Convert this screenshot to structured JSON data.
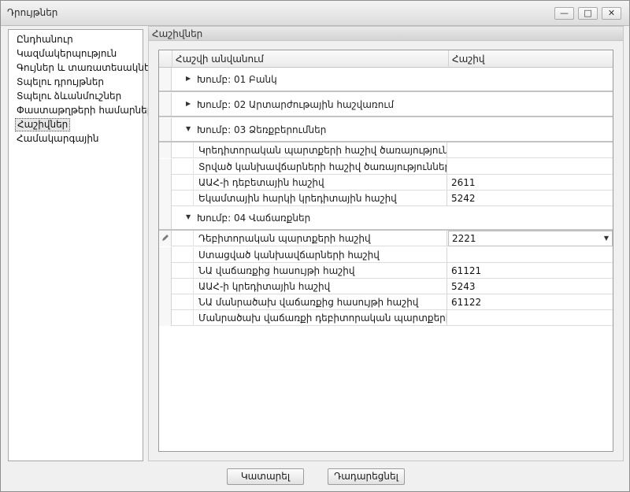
{
  "window": {
    "title": "Դրույթներ",
    "controls": {
      "minimize": "—",
      "maximize": "□",
      "close": "✕"
    }
  },
  "nav": {
    "items": [
      {
        "label": "Ընդհանուր",
        "selected": false
      },
      {
        "label": "Կազմակերպություն",
        "selected": false
      },
      {
        "label": "Գույներ և տառատեսակներ",
        "selected": false
      },
      {
        "label": "Տպելու դրույթներ",
        "selected": false
      },
      {
        "label": "Տպելու ձևանմուշներ",
        "selected": false
      },
      {
        "label": "Փաստաթղթերի համարներ",
        "selected": false
      },
      {
        "label": "Հաշիվներ",
        "selected": true
      },
      {
        "label": "Համակարգային",
        "selected": false
      }
    ]
  },
  "content": {
    "section_title": "Հաշիվներ",
    "grid": {
      "columns": [
        "Հաշվի անվանում",
        "Հաշիվ"
      ],
      "groups": [
        {
          "label": "Խումբ: 01 Բանկ",
          "expanded": false,
          "rows": []
        },
        {
          "label": "Խումբ: 02 Արտարժութային հաշվառում",
          "expanded": false,
          "rows": []
        },
        {
          "label": "Խումբ: 03 Ձեռքբերումներ",
          "expanded": true,
          "rows": [
            {
              "name": "Կրեդիտորական պարտքերի հաշիվ ծառայություններ...",
              "account": ""
            },
            {
              "name": "Տրված կանխավճարների հաշիվ ծառայություններ...",
              "account": ""
            },
            {
              "name": "ԱԱՀ-ի դեբետային հաշիվ",
              "account": "2611"
            },
            {
              "name": "Եկամտային հարկի կրեդիտային հաշիվ",
              "account": "5242"
            }
          ]
        },
        {
          "label": "Խումբ: 04 Վաճառքներ",
          "expanded": true,
          "rows": [
            {
              "name": "Դեբիտորական պարտքերի հաշիվ",
              "account": "2221",
              "active": true
            },
            {
              "name": "Ստացված կանխավճարների հաշիվ",
              "account": ""
            },
            {
              "name": "ՆԱ վաճառքից հասույթի հաշիվ",
              "account": "61121"
            },
            {
              "name": "ԱԱՀ-ի կրեդիտային հաշիվ",
              "account": "5243"
            },
            {
              "name": "ՆԱ մանրածախ վաճառքից հասույթի հաշիվ",
              "account": "61122"
            },
            {
              "name": "Մանրածախ վաճառքի դեբիտորական պարտքերի հա...",
              "account": ""
            }
          ]
        }
      ]
    }
  },
  "footer": {
    "ok_label": "Կատարել",
    "cancel_label": "Դադարեցնել"
  },
  "icons": {
    "collapsed": "▶",
    "expanded": "▼",
    "dropdown": "▼",
    "edit": "pencil-icon"
  }
}
